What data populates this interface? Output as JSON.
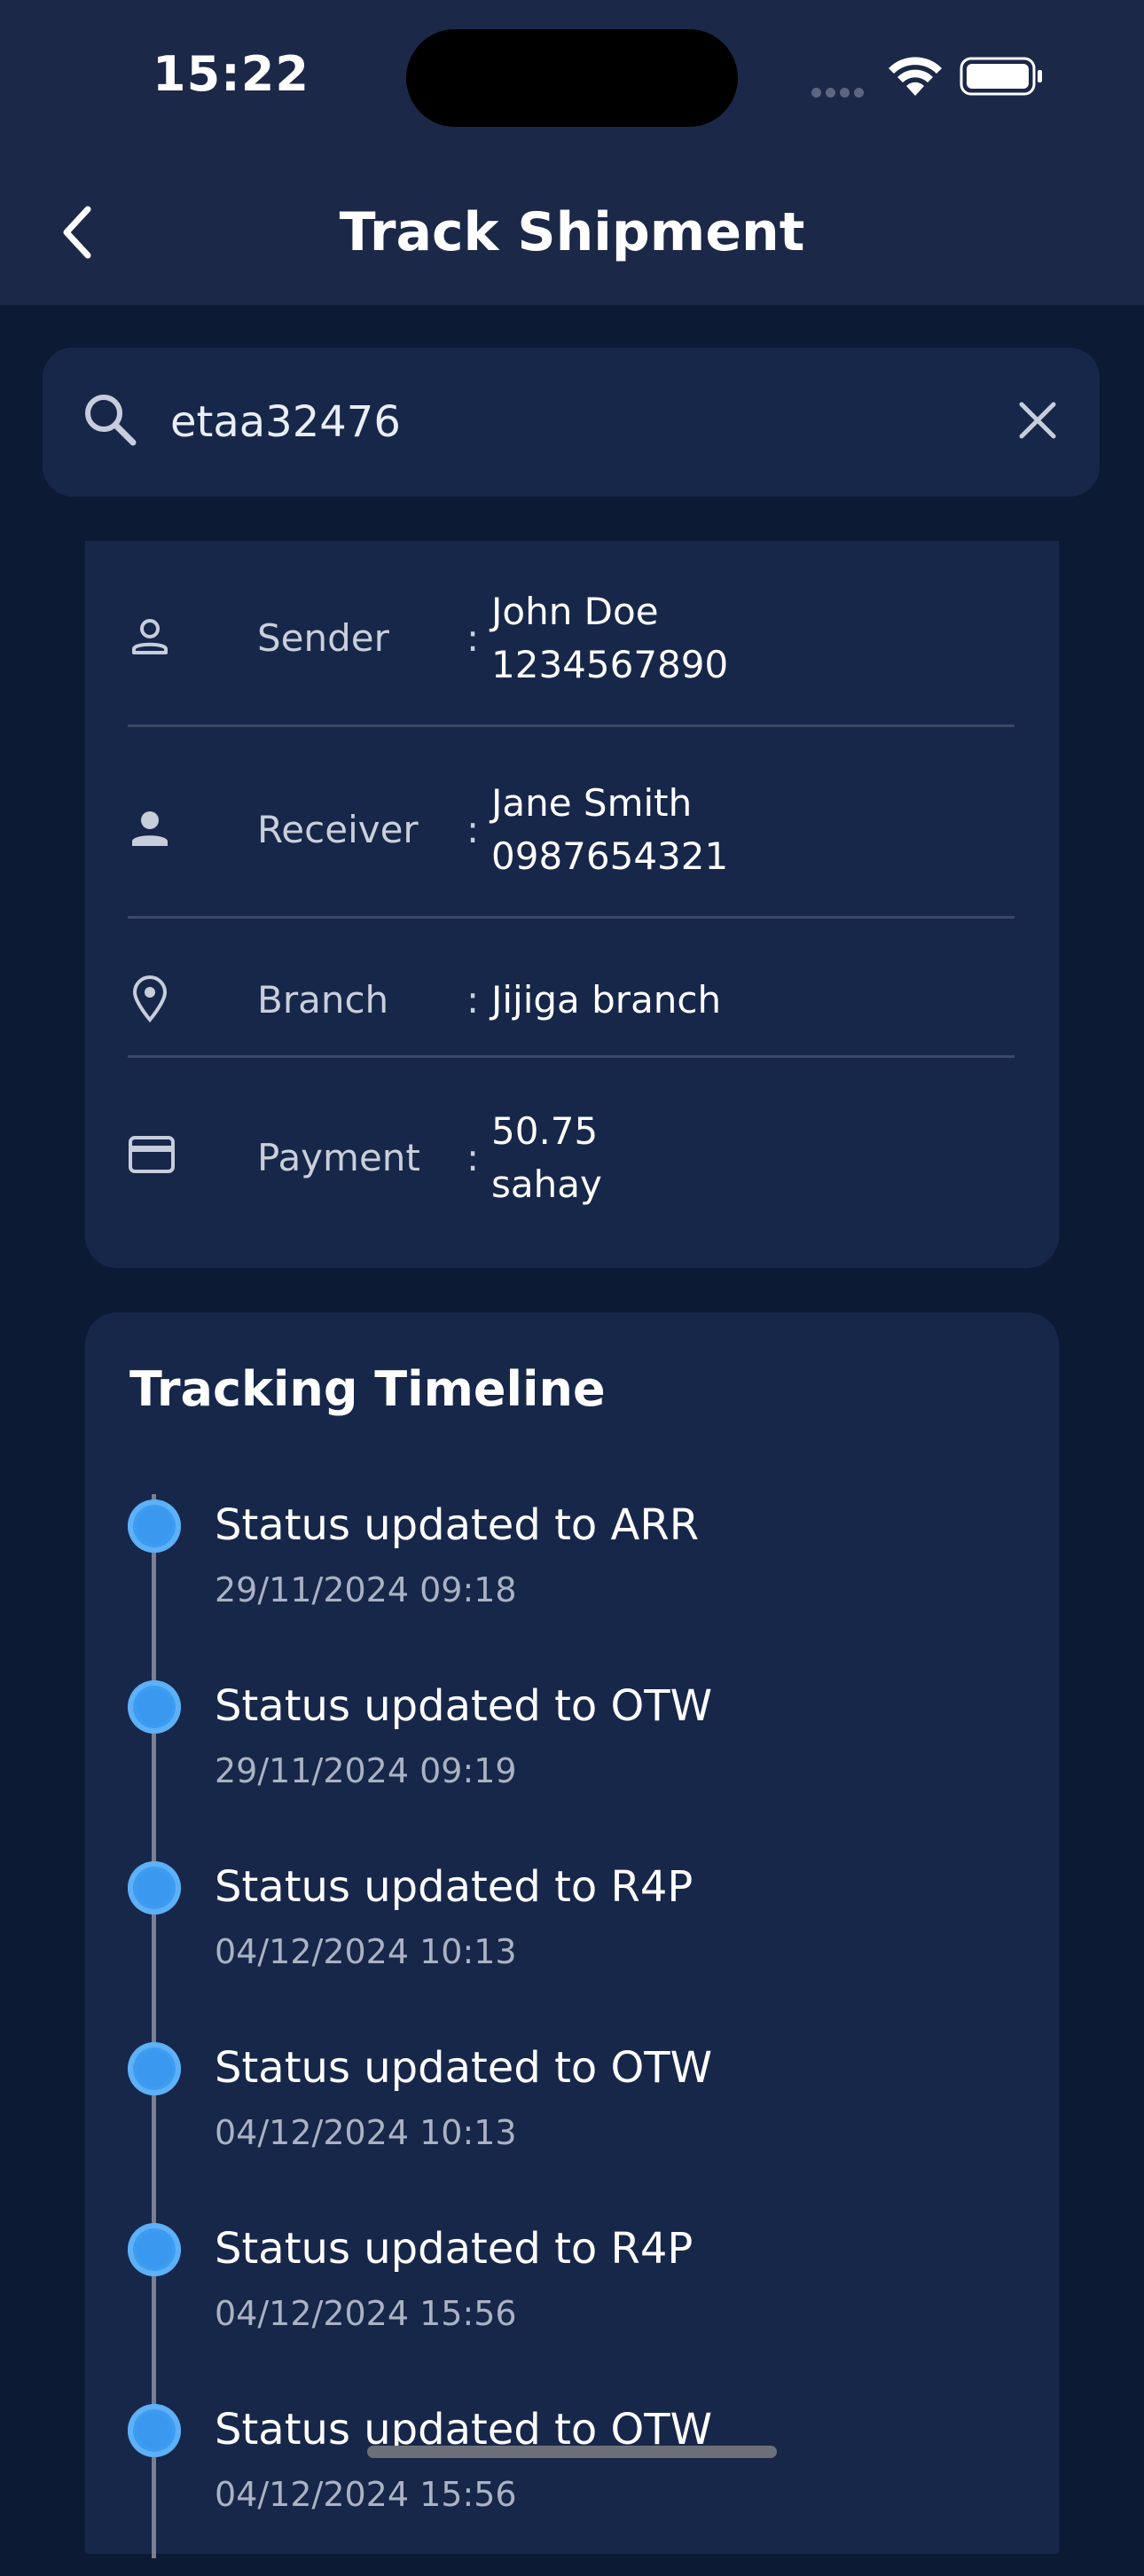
{
  "status_bar": {
    "time": "15:22"
  },
  "header": {
    "title": "Track Shipment"
  },
  "search": {
    "value": "etaa32476"
  },
  "info": {
    "separator": ":",
    "rows": [
      {
        "label": "Sender",
        "line1": "John Doe",
        "line2": "1234567890"
      },
      {
        "label": "Receiver",
        "line1": "Jane Smith",
        "line2": "0987654321"
      },
      {
        "label": "Branch",
        "line1": "Jijiga branch"
      },
      {
        "label": "Payment",
        "line1": "50.75",
        "line2": "sahay"
      }
    ]
  },
  "timeline": {
    "title": "Tracking Timeline",
    "items": [
      {
        "status": "Status updated to ARR",
        "time": "29/11/2024 09:18"
      },
      {
        "status": "Status updated to OTW",
        "time": "29/11/2024 09:19"
      },
      {
        "status": "Status updated to R4P",
        "time": "04/12/2024 10:13"
      },
      {
        "status": "Status updated to OTW",
        "time": "04/12/2024 10:13"
      },
      {
        "status": "Status updated to R4P",
        "time": "04/12/2024 15:56"
      },
      {
        "status": "Status updated to OTW",
        "time": "04/12/2024 15:56"
      }
    ]
  },
  "colors": {
    "background": "#0d1a33",
    "card": "#17274a",
    "appbar": "#1b2847",
    "accent": "#3c9cf2"
  }
}
